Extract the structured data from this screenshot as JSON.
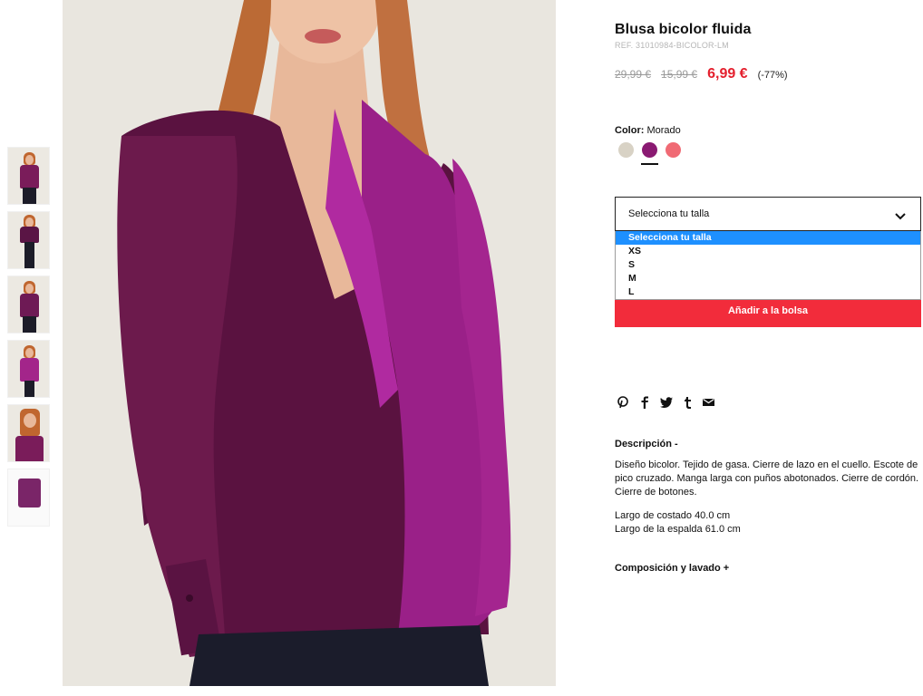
{
  "product": {
    "title": "Blusa bicolor fluida",
    "ref": "REF. 31010984-BICOLOR-LM",
    "price_original": "29,99 €",
    "price_previous": "15,99 €",
    "price_current": "6,99 €",
    "discount": "(-77%)"
  },
  "color": {
    "label": "Color:",
    "value": "Morado",
    "swatches": [
      {
        "name": "beige",
        "hex": "#d8d2c5"
      },
      {
        "name": "morado",
        "hex": "#8a1a72"
      },
      {
        "name": "coral",
        "hex": "#f06a74"
      }
    ]
  },
  "size": {
    "placeholder": "Selecciona tu talla",
    "options": [
      "Selecciona tu talla",
      "XS",
      "S",
      "M",
      "L"
    ]
  },
  "cart": {
    "add_label": "Añadir a la bolsa"
  },
  "share": {
    "icons": [
      "pinterest-icon",
      "facebook-icon",
      "twitter-icon",
      "tumblr-icon",
      "email-icon"
    ]
  },
  "description": {
    "title": "Descripción -",
    "text": "Diseño bicolor. Tejido de gasa. Cierre de lazo en el cuello. Escote de pico cruzado. Manga larga con puños abotonados. Cierre de cordón. Cierre de botones.",
    "length_side": "Largo de costado 40.0 cm",
    "length_back": "Largo de la espalda 61.0 cm"
  },
  "composition": {
    "title": "Composición y lavado +"
  },
  "colors": {
    "accent_red": "#e4202e",
    "button_red": "#f22c3b",
    "select_blue": "#1e90ff"
  }
}
